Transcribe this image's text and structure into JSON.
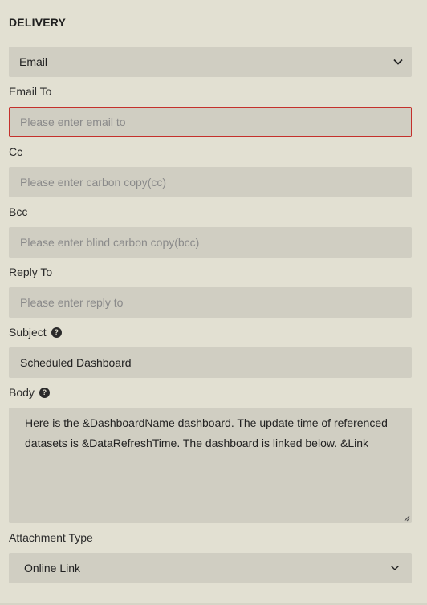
{
  "delivery": {
    "section_title": "DELIVERY",
    "method": {
      "value": "Email"
    }
  },
  "email_to": {
    "label": "Email To",
    "placeholder": "Please enter email to",
    "value": ""
  },
  "cc": {
    "label": "Cc",
    "placeholder": "Please enter carbon copy(cc)",
    "value": ""
  },
  "bcc": {
    "label": "Bcc",
    "placeholder": "Please enter blind carbon copy(bcc)",
    "value": ""
  },
  "reply_to": {
    "label": "Reply To",
    "placeholder": "Please enter reply to",
    "value": ""
  },
  "subject": {
    "label": "Subject",
    "value": "Scheduled Dashboard",
    "help_icon": "question-circle-icon"
  },
  "body": {
    "label": "Body",
    "help_icon": "question-circle-icon",
    "value": "Here is the &DashboardName dashboard. The update time of referenced datasets is &DataRefreshTime. The dashboard is linked below. &Link"
  },
  "attachment_type": {
    "label": "Attachment Type",
    "value": "Online Link"
  },
  "colors": {
    "background": "#e2e0d2",
    "field": "#d0cec2",
    "error_border": "#c4302b"
  }
}
